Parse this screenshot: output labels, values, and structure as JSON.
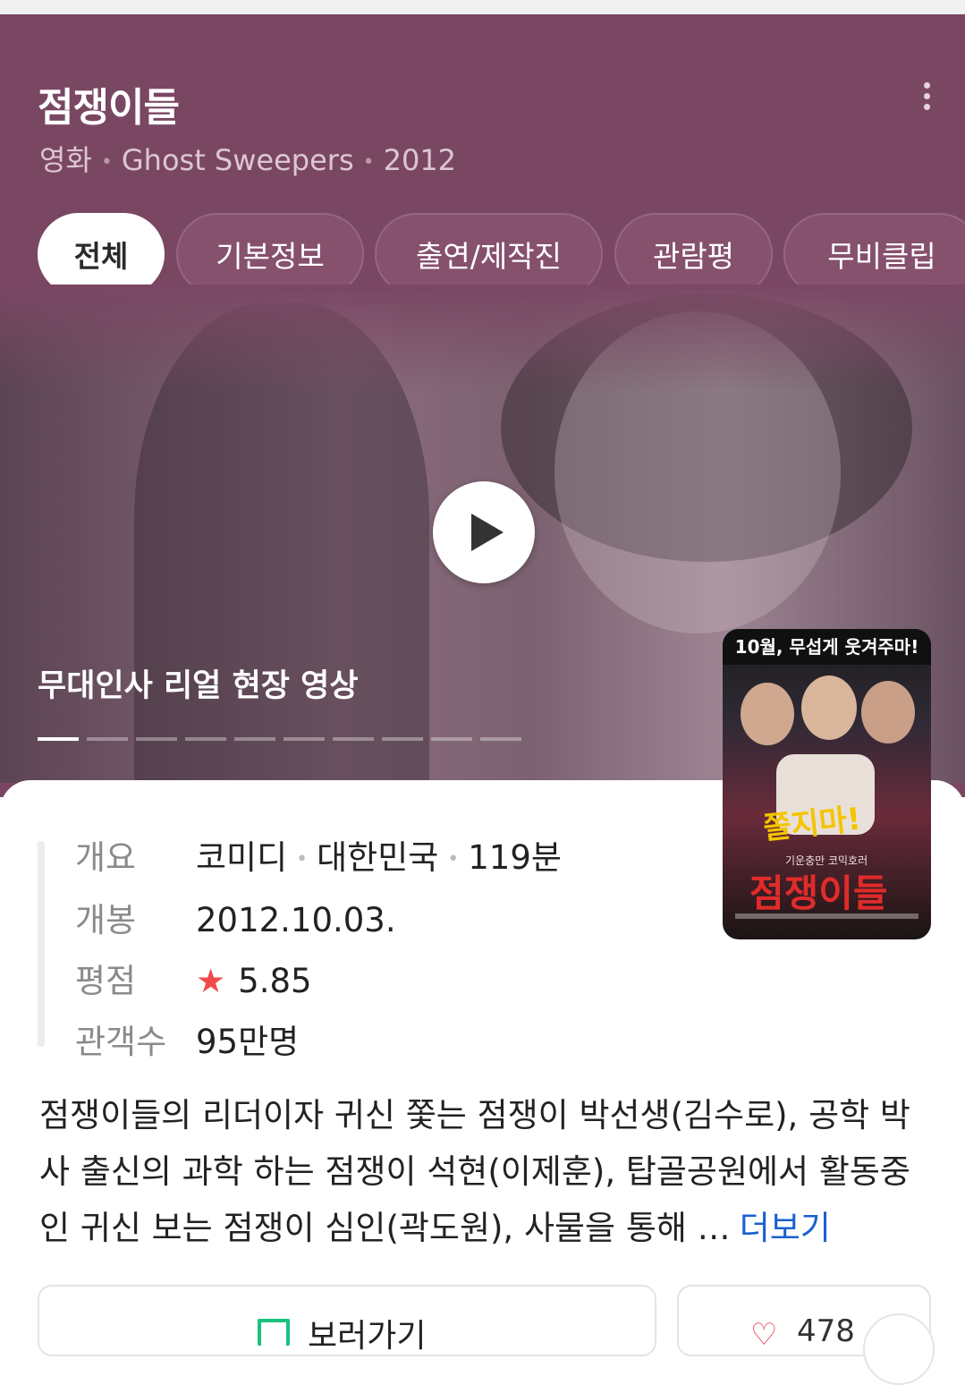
{
  "movie": {
    "title": "점쟁이들",
    "subtitle": {
      "type": "영화",
      "english_title": "Ghost Sweepers",
      "year": "2012"
    }
  },
  "tabs": [
    {
      "label": "전체",
      "active": true
    },
    {
      "label": "기본정보"
    },
    {
      "label": "출연/제작진"
    },
    {
      "label": "관람평"
    },
    {
      "label": "무비클립"
    }
  ],
  "video": {
    "title": "무대인사 리얼 현장 영상",
    "play_icon": "play-icon",
    "slide_count": 10,
    "active_slide": 1
  },
  "poster": {
    "tagline": "10월, 무섭게 웃겨주마!",
    "tagline2": "쫄지마!",
    "small_text": "기운충만 코믹호러",
    "title_text": "점쟁이들"
  },
  "info": {
    "overview": {
      "label": "개요",
      "genre": "코미디",
      "country": "대한민국",
      "runtime": "119분"
    },
    "release": {
      "label": "개봉",
      "value": "2012.10.03."
    },
    "rating": {
      "label": "평점",
      "value": "5.85",
      "icon": "star-icon"
    },
    "audience": {
      "label": "관객수",
      "value": "95만명"
    }
  },
  "description": {
    "text": "점쟁이들의 리더이자 귀신 쫓는 점쟁이 박선생(김수로), 공학 박사 출신의 과학 하는 점쟁이 석현(이제훈), 탑골공원에서 활동중인 귀신 보는 점쟁이 심인(곽도원), 사물을 통해 …",
    "more_label": "더보기"
  },
  "actions": {
    "watch_label": "보러가기",
    "like_count": "478"
  },
  "colors": {
    "header_bg": "#7a4763",
    "accent_link": "#1a5fd1",
    "star": "#f04a4a",
    "watch_icon": "#19c37d"
  }
}
